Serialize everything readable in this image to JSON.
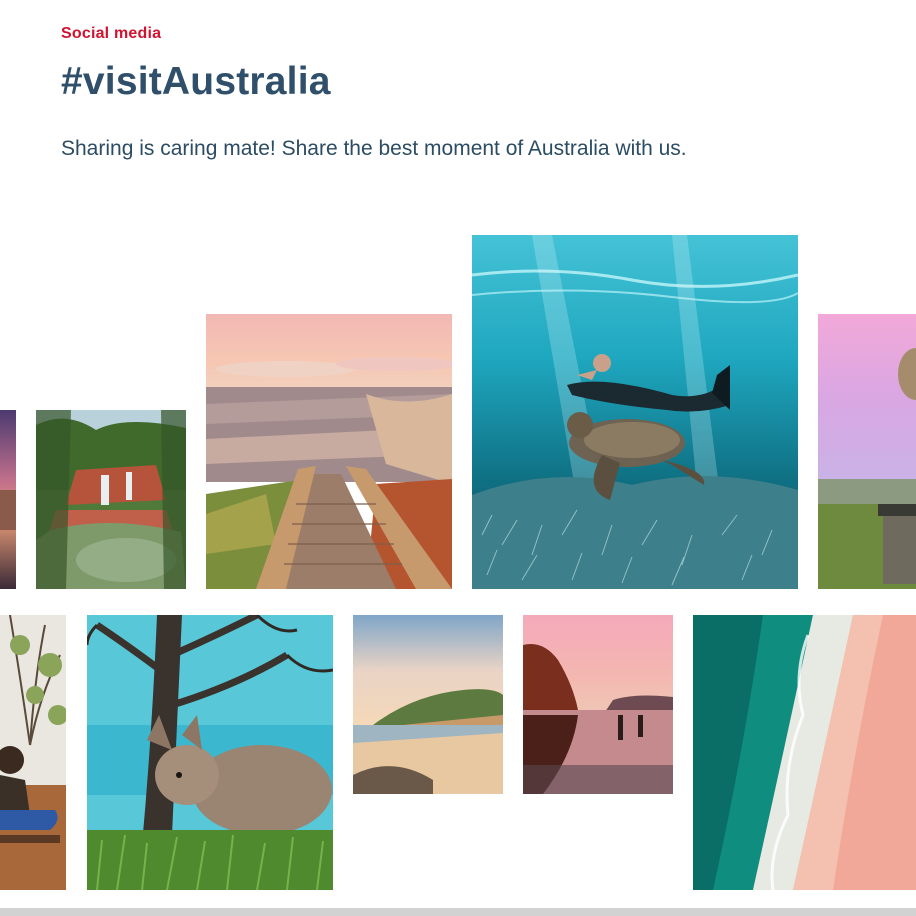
{
  "header": {
    "eyebrow": "Social media",
    "title": "#visitAustralia",
    "subtitle": "Sharing is caring mate! Share the best moment of Australia with us."
  },
  "gallery": {
    "photos": [
      {
        "subject": "sunset-cliff"
      },
      {
        "subject": "waterfall-pools"
      },
      {
        "subject": "boardwalk-beach"
      },
      {
        "subject": "diver-sea-turtle"
      },
      {
        "subject": "person-pink-sky"
      },
      {
        "subject": "aboriginal-artist"
      },
      {
        "subject": "kangaroo-tree"
      },
      {
        "subject": "beach-cove"
      },
      {
        "subject": "red-rock-reflection"
      },
      {
        "subject": "aerial-pink-beach"
      }
    ]
  },
  "colors": {
    "accent": "#d1122f",
    "heading": "#2f4f6a",
    "text": "#2b4c63"
  }
}
